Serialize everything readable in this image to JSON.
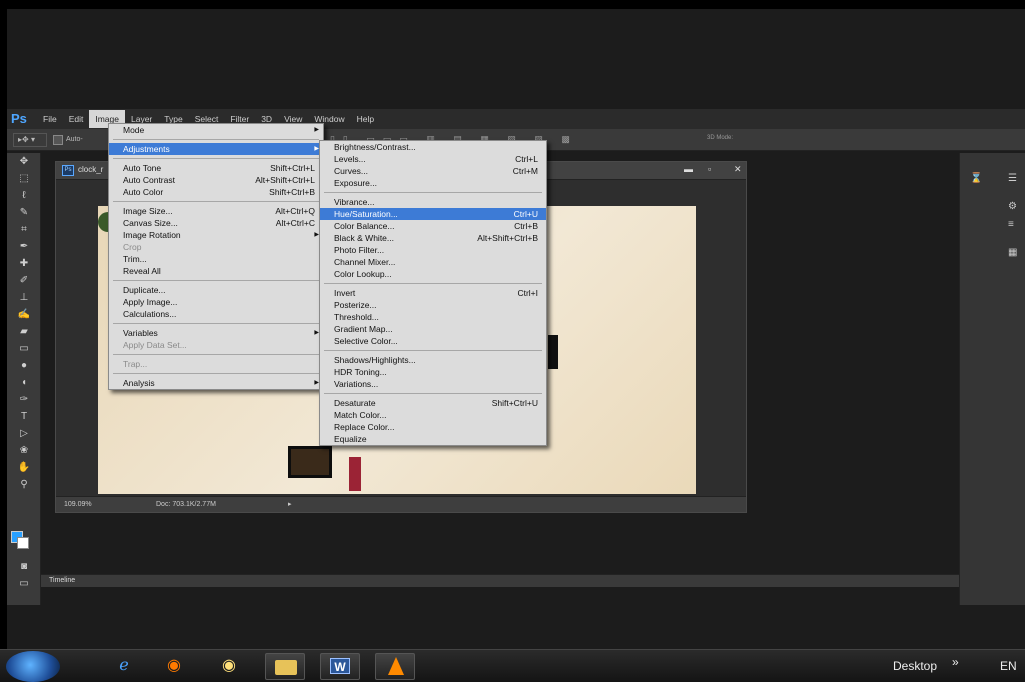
{
  "app": {
    "logo": "Ps"
  },
  "menubar": [
    {
      "label": "File"
    },
    {
      "label": "Edit"
    },
    {
      "label": "Image",
      "active": true
    },
    {
      "label": "Layer"
    },
    {
      "label": "Type"
    },
    {
      "label": "Select"
    },
    {
      "label": "Filter"
    },
    {
      "label": "3D"
    },
    {
      "label": "View"
    },
    {
      "label": "Window"
    },
    {
      "label": "Help"
    }
  ],
  "options_bar": {
    "auto_label": "Auto-",
    "mode_3d_label": "3D Mode:"
  },
  "image_menu": {
    "items": [
      {
        "label": "Mode",
        "submenu": true
      },
      {
        "sep": true
      },
      {
        "label": "Adjustments",
        "submenu": true,
        "highlight": true
      },
      {
        "sep": true
      },
      {
        "label": "Auto Tone",
        "shortcut": "Shift+Ctrl+L"
      },
      {
        "label": "Auto Contrast",
        "shortcut": "Alt+Shift+Ctrl+L"
      },
      {
        "label": "Auto Color",
        "shortcut": "Shift+Ctrl+B"
      },
      {
        "sep": true
      },
      {
        "label": "Image Size...",
        "shortcut": "Alt+Ctrl+Q"
      },
      {
        "label": "Canvas Size...",
        "shortcut": "Alt+Ctrl+C"
      },
      {
        "label": "Image Rotation",
        "submenu": true
      },
      {
        "label": "Crop",
        "disabled": true
      },
      {
        "label": "Trim..."
      },
      {
        "label": "Reveal All"
      },
      {
        "sep": true
      },
      {
        "label": "Duplicate..."
      },
      {
        "label": "Apply Image..."
      },
      {
        "label": "Calculations..."
      },
      {
        "sep": true
      },
      {
        "label": "Variables",
        "submenu": true
      },
      {
        "label": "Apply Data Set...",
        "disabled": true
      },
      {
        "sep": true
      },
      {
        "label": "Trap...",
        "disabled": true
      },
      {
        "sep": true
      },
      {
        "label": "Analysis",
        "submenu": true
      }
    ]
  },
  "adjustments_menu": {
    "items": [
      {
        "label": "Brightness/Contrast..."
      },
      {
        "label": "Levels...",
        "shortcut": "Ctrl+L"
      },
      {
        "label": "Curves...",
        "shortcut": "Ctrl+M"
      },
      {
        "label": "Exposure..."
      },
      {
        "sep": true
      },
      {
        "label": "Vibrance..."
      },
      {
        "label": "Hue/Saturation...",
        "shortcut": "Ctrl+U",
        "highlight": true
      },
      {
        "label": "Color Balance...",
        "shortcut": "Ctrl+B"
      },
      {
        "label": "Black & White...",
        "shortcut": "Alt+Shift+Ctrl+B"
      },
      {
        "label": "Photo Filter..."
      },
      {
        "label": "Channel Mixer..."
      },
      {
        "label": "Color Lookup..."
      },
      {
        "sep": true
      },
      {
        "label": "Invert",
        "shortcut": "Ctrl+I"
      },
      {
        "label": "Posterize..."
      },
      {
        "label": "Threshold..."
      },
      {
        "label": "Gradient Map..."
      },
      {
        "label": "Selective Color..."
      },
      {
        "sep": true
      },
      {
        "label": "Shadows/Highlights..."
      },
      {
        "label": "HDR Toning..."
      },
      {
        "label": "Variations..."
      },
      {
        "sep": true
      },
      {
        "label": "Desaturate",
        "shortcut": "Shift+Ctrl+U"
      },
      {
        "label": "Match Color..."
      },
      {
        "label": "Replace Color..."
      },
      {
        "label": "Equalize"
      }
    ]
  },
  "document": {
    "name": "clock_r",
    "zoom": "109.09%",
    "doc_info": "Doc: 703.1K/2.77M",
    "min_icon": "minimize-icon",
    "max_icon": "maximize-icon",
    "close_icon": "close-icon"
  },
  "panels": {
    "timeline_label": "Timeline"
  },
  "taskbar": {
    "desktop_label": "Desktop",
    "arrows": "»",
    "language": "EN"
  },
  "colors": {
    "menu_highlight": "#3d7bd6",
    "menu_bg": "#dcdcdc",
    "ps_blue": "#4ea6ff",
    "foreground_swatch": "#29a0ff"
  }
}
